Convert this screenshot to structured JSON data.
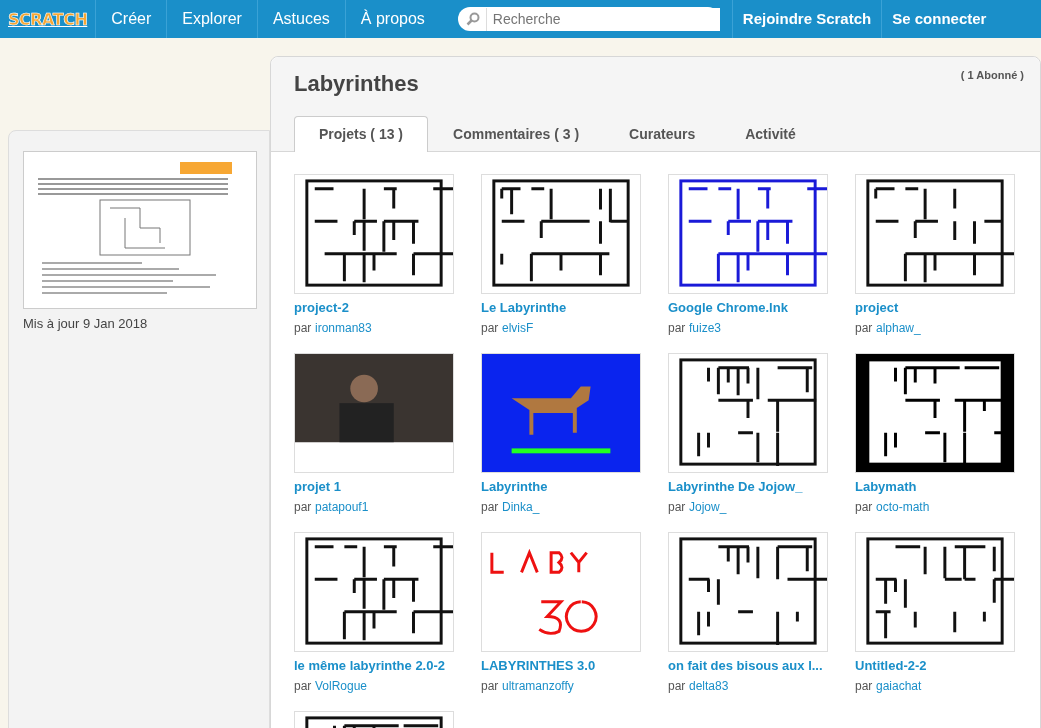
{
  "navbar": {
    "logo": "SCRATCH",
    "links": [
      "Créer",
      "Explorer",
      "Astuces",
      "À propos"
    ],
    "search": {
      "placeholder": "Recherche"
    },
    "actions": [
      "Rejoindre Scratch",
      "Se connecter"
    ]
  },
  "sidebar": {
    "updated": "Mis à jour 9 Jan 2018"
  },
  "studio": {
    "title": "Labyrinthes",
    "followers": "( 1 Abonné )"
  },
  "tabs": [
    {
      "label": "Projets ( 13 )",
      "selected": true
    },
    {
      "label": "Commentaires ( 3 )",
      "selected": false
    },
    {
      "label": "Curateurs",
      "selected": false
    },
    {
      "label": "Activité",
      "selected": false
    }
  ],
  "projects": [
    {
      "title": "project-2",
      "by": "par",
      "author": "ironman83",
      "kind": "maze"
    },
    {
      "title": "Le Labyrinthe",
      "by": "par",
      "author": "elvisF",
      "kind": "maze"
    },
    {
      "title": "Google Chrome.lnk",
      "by": "par",
      "author": "fuize3",
      "kind": "blue-maze"
    },
    {
      "title": "project",
      "by": "par",
      "author": "alphaw_",
      "kind": "maze"
    },
    {
      "title": "projet 1",
      "by": "par",
      "author": "patapouf1",
      "kind": "photo"
    },
    {
      "title": "Labyrinthe",
      "by": "par",
      "author": "Dinka_",
      "kind": "game"
    },
    {
      "title": "Labyrinthe De Jojow_",
      "by": "par",
      "author": "Jojow_",
      "kind": "maze"
    },
    {
      "title": "Labymath",
      "by": "par",
      "author": "octo-math",
      "kind": "dark-maze"
    },
    {
      "title": "le même labyrinthe 2.0-2",
      "by": "par",
      "author": "VolRogue",
      "kind": "maze"
    },
    {
      "title": "LABYRINTHES 3.0",
      "by": "par",
      "author": "ultramanzoffy",
      "kind": "sketch"
    },
    {
      "title": "on fait des bisous aux l...",
      "by": "par",
      "author": "delta83",
      "kind": "maze"
    },
    {
      "title": "Untitled-2-2",
      "by": "par",
      "author": "gaiachat",
      "kind": "maze"
    },
    {
      "kind": "maze"
    }
  ]
}
